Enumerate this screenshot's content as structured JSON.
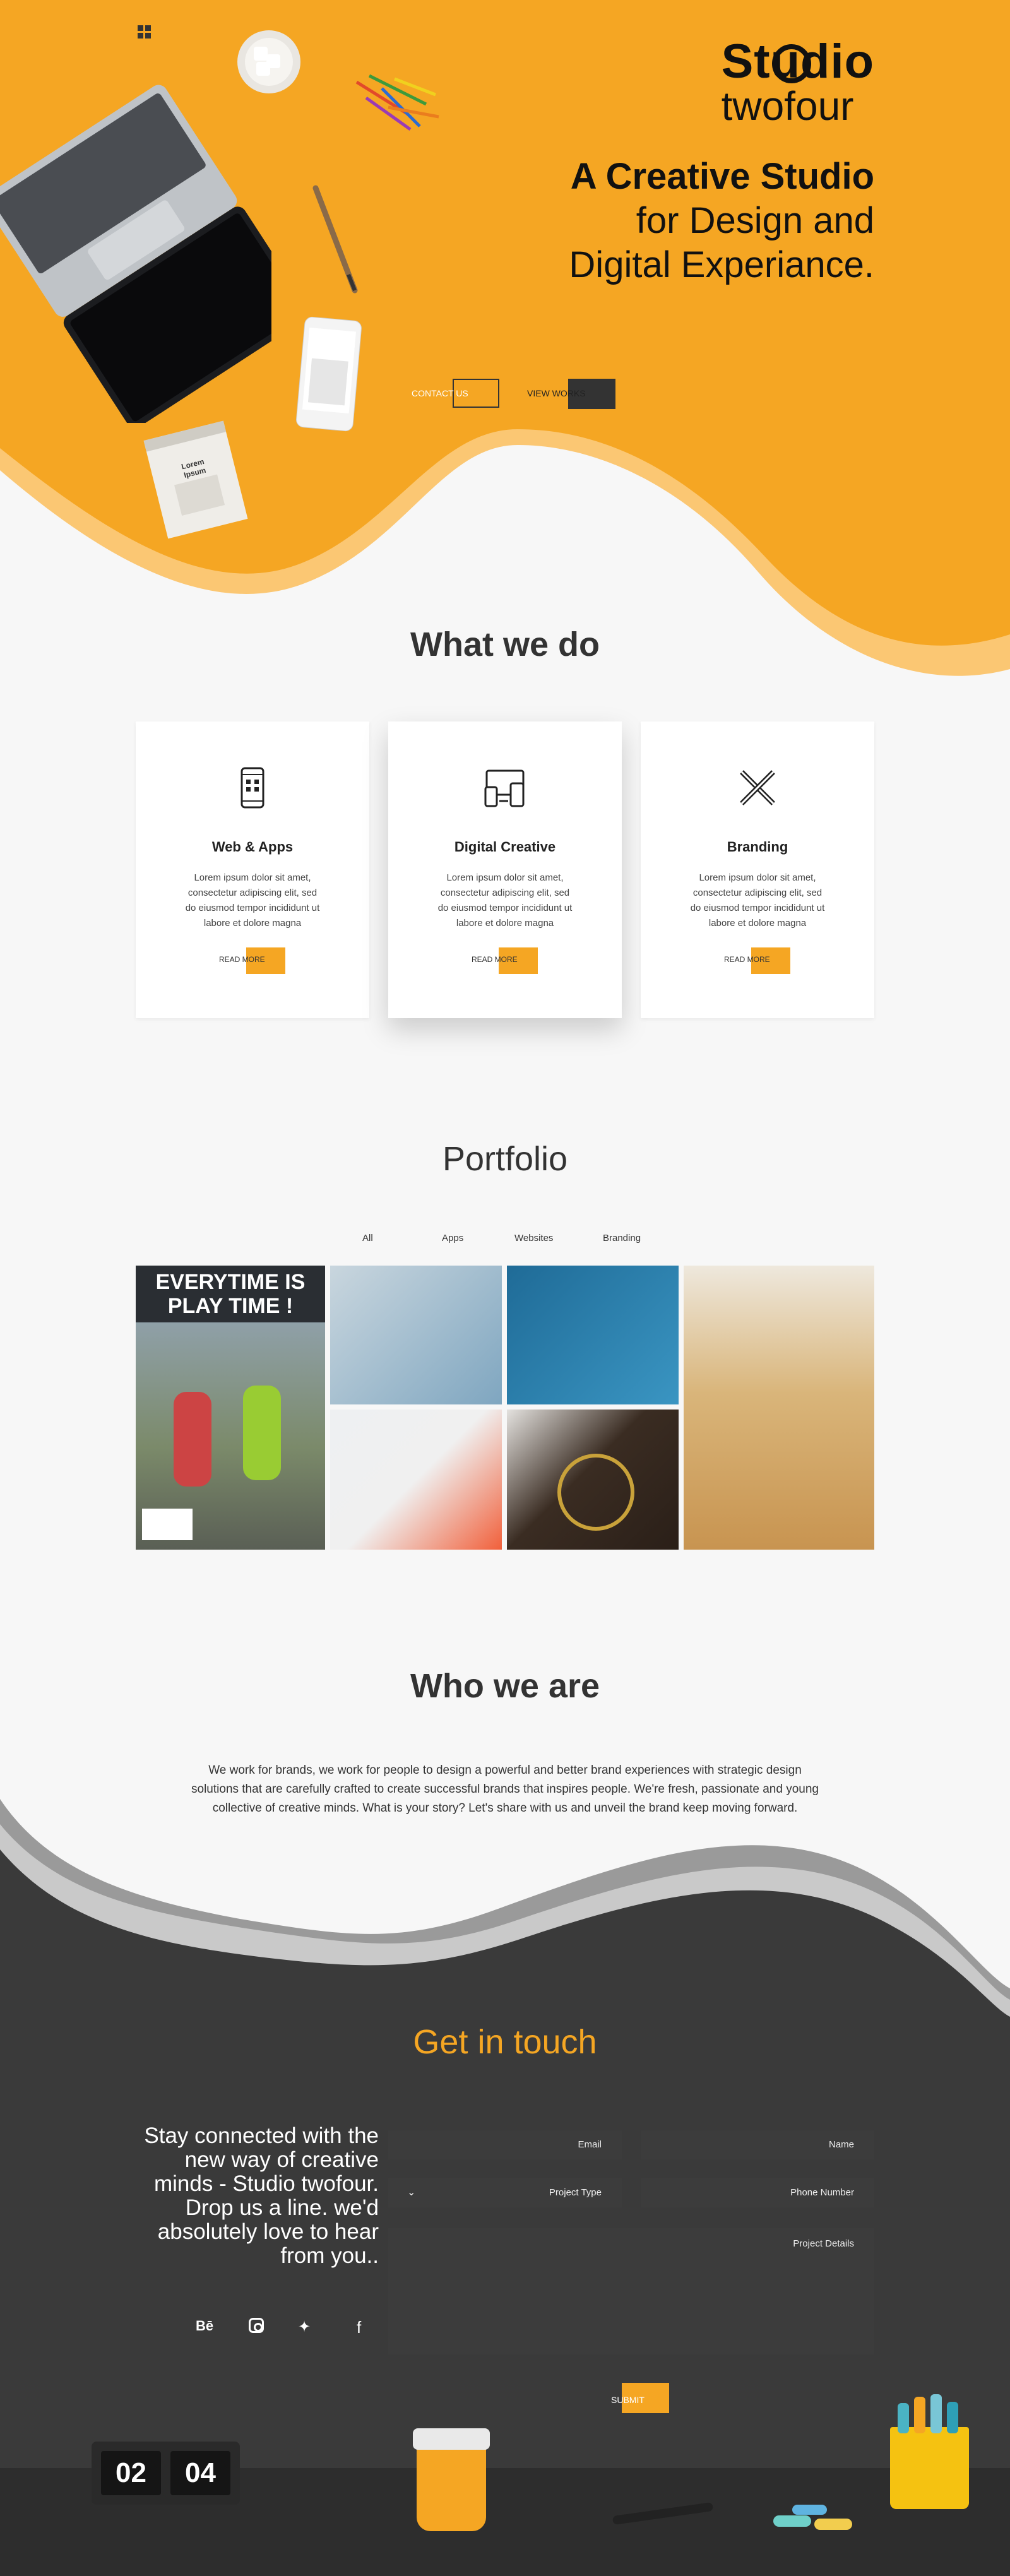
{
  "brand": {
    "line1": "Studio",
    "line2": "twofour"
  },
  "hero": {
    "line1": "A Creative Studio",
    "line2": "for Design and",
    "line3": "Digital Experiance.",
    "view_works": "VIEW WORKS",
    "contact_us": "CONTACT US",
    "notepad_text": "Lorem Ipsum"
  },
  "what_we_do": {
    "title": "What we do",
    "cards": [
      {
        "title": "Web & Apps",
        "desc": "Lorem ipsum dolor sit amet, consectetur adipiscing elit, sed do eiusmod tempor incididunt ut labore et dolore magna",
        "button": "READ MORE",
        "icon": "mobile-web-icon"
      },
      {
        "title": "Digital Creative",
        "desc": "Lorem ipsum dolor sit amet, consectetur adipiscing elit, sed do eiusmod tempor incididunt ut labore et dolore magna",
        "button": "READ MORE",
        "icon": "devices-icon"
      },
      {
        "title": "Branding",
        "desc": "Lorem ipsum dolor sit amet, consectetur adipiscing elit, sed do eiusmod tempor incididunt ut labore et dolore magna",
        "button": "READ MORE",
        "icon": "pencil-ruler-icon"
      }
    ]
  },
  "portfolio": {
    "title": "Portfolio",
    "filters": [
      "All",
      "Apps",
      "Websites",
      "Branding"
    ],
    "poster_text_1": "EVERYTIME IS",
    "poster_text_2": "PLAY TIME !"
  },
  "who_we_are": {
    "title": "Who we are",
    "text": "We work for brands, we work for people to design a powerful and better brand experiences with strategic design solutions that are carefully crafted to create successful brands that inspires people. We're fresh, passionate and young collective of creative minds. What is your story? Let's share with us and unveil the brand keep moving forward."
  },
  "contact": {
    "title": "Get in touch",
    "tagline": "Stay connected with the new way of creative minds - Studio twofour. Drop us a line. we'd absolutely love to hear from you..",
    "fields": {
      "name": "Name",
      "email": "Email",
      "phone": "Phone Number",
      "project_type": "Project Type",
      "details": "Project Details"
    },
    "submit": "SUBMIT",
    "social": [
      "facebook-icon",
      "twitter-icon",
      "instagram-icon",
      "behance-icon"
    ],
    "clock": {
      "left": "02",
      "right": "04"
    }
  },
  "colors": {
    "accent": "#f5a623",
    "dark": "#333333",
    "light": "#f7f7f7"
  }
}
